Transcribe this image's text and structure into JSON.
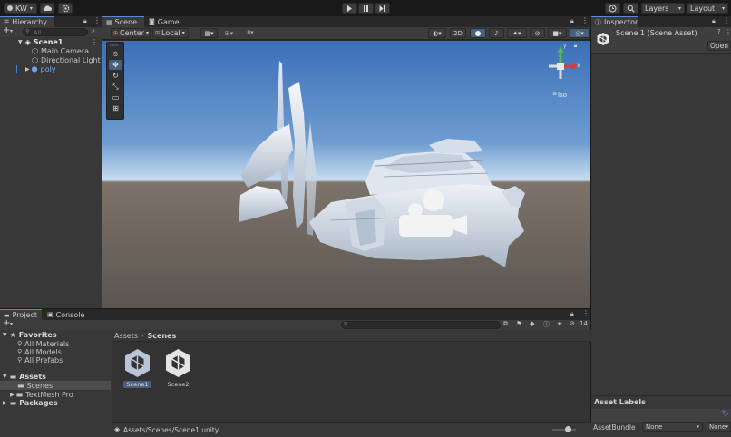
{
  "toolbar": {
    "account": "KW",
    "layers": "Layers",
    "layout": "Layout"
  },
  "hierarchy": {
    "tab": "Hierarchy",
    "search_placeholder": "All",
    "scene": "Scene1",
    "items": [
      "Main Camera",
      "Directional Light",
      "poly"
    ]
  },
  "scene_view": {
    "tabs": [
      "Scene",
      "Game"
    ],
    "pivot": "Center",
    "space": "Local",
    "mode_2d": "2D",
    "gizmo_label": "Iso",
    "gizmo_axes": [
      "y",
      "x"
    ],
    "tools_label": "tools"
  },
  "inspector": {
    "tab": "Inspector",
    "title": "Scene 1 (Scene Asset)",
    "open": "Open",
    "asset_labels": "Asset Labels",
    "asset_bundle": "AssetBundle",
    "bundle_value": "None",
    "variant_value": "None"
  },
  "project": {
    "tabs": [
      "Project",
      "Console"
    ],
    "favorites": "Favorites",
    "favorite_items": [
      "All Materials",
      "All Models",
      "All Prefabs"
    ],
    "assets": "Assets",
    "asset_items": [
      "Scenes",
      "TextMesh Pro"
    ],
    "packages": "Packages",
    "breadcrumb": [
      "Assets",
      "Scenes"
    ],
    "files": [
      "Scene1",
      "Scene2"
    ],
    "status_path": "Assets/Scenes/Scene1.unity",
    "hidden_count": "14"
  },
  "colors": {
    "accent": "#4a7dd6",
    "sky_top": "#3a6fb8",
    "sky_bottom": "#c8dcef",
    "ground": "#5c5550"
  }
}
